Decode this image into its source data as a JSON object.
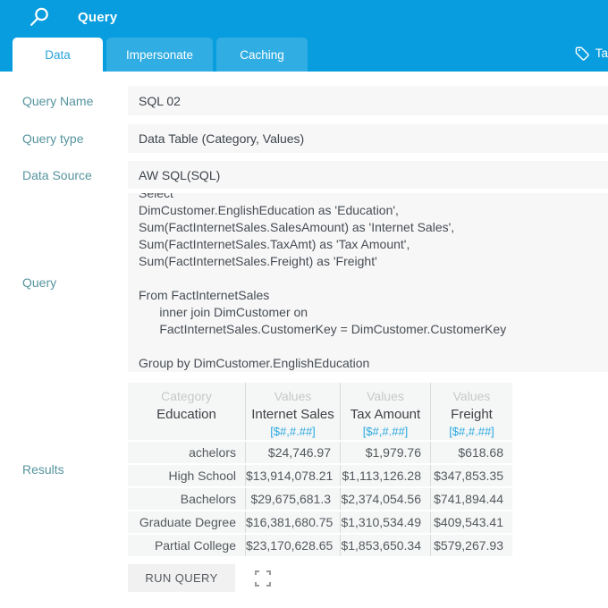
{
  "header": {
    "title": "Query"
  },
  "tabs": [
    {
      "label": "Data",
      "active": true
    },
    {
      "label": "Impersonate",
      "active": false
    },
    {
      "label": "Caching",
      "active": false
    }
  ],
  "tag": {
    "label": "Ta"
  },
  "form": {
    "query_name": {
      "label": "Query Name",
      "value": "SQL 02"
    },
    "query_type": {
      "label": "Query type",
      "value": "Data Table (Category, Values)"
    },
    "data_source": {
      "label": "Data Source",
      "value": "AW SQL(SQL)"
    },
    "query": {
      "label": "Query",
      "value": "Select\nDimCustomer.EnglishEducation as 'Education',\nSum(FactInternetSales.SalesAmount) as 'Internet Sales',\nSum(FactInternetSales.TaxAmt) as 'Tax Amount',\nSum(FactInternetSales.Freight) as 'Freight'\n\nFrom FactInternetSales\n      inner join DimCustomer on\n      FactInternetSales.CustomerKey = DimCustomer.CustomerKey\n\nGroup by DimCustomer.EnglishEducation"
    },
    "results": {
      "label": "Results"
    }
  },
  "results_table": {
    "columns": [
      {
        "group": "Category",
        "name": "Education",
        "format": ""
      },
      {
        "group": "Values",
        "name": "Internet Sales",
        "format": "[$#,#.##]"
      },
      {
        "group": "Values",
        "name": "Tax Amount",
        "format": "[$#,#.##]"
      },
      {
        "group": "Values",
        "name": "Freight",
        "format": "[$#,#.##]"
      }
    ],
    "rows": [
      [
        "achelors",
        "$24,746.97",
        "$1,979.76",
        "$618.68"
      ],
      [
        "High School",
        "$13,914,078.21",
        "$1,113,126.28",
        "$347,853.35"
      ],
      [
        "Bachelors",
        "$29,675,681.3",
        "$2,374,054.56",
        "$741,894.44"
      ],
      [
        "Graduate Degree",
        "$16,381,680.75",
        "$1,310,534.49",
        "$409,543.41"
      ],
      [
        "Partial College",
        "$23,170,628.65",
        "$1,853,650.34",
        "$579,267.93"
      ]
    ]
  },
  "actions": {
    "run_query": "RUN QUERY"
  },
  "colors": {
    "header_blue": "#089dde",
    "inactive_tab_blue": "#30ade2",
    "active_tab_text": "#29a4dc",
    "label_teal": "#56949e",
    "field_background": "#f7f7f7",
    "format_link_blue": "#29a9e1",
    "table_cell_background": "#f5f6f6"
  }
}
